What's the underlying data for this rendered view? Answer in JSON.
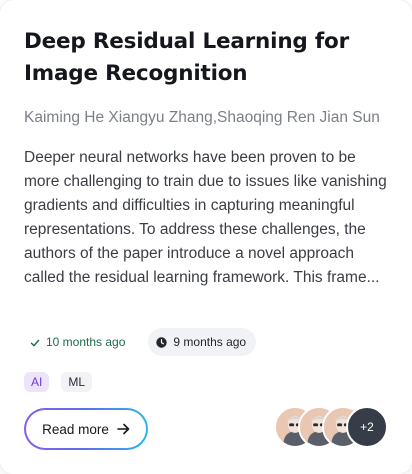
{
  "card": {
    "title": "Deep Residual Learning for Image Recognition",
    "authors": "Kaiming He Xiangyu Zhang,Shaoqing Ren Jian Sun",
    "abstract": "Deeper neural networks have been proven to be more challenging to train due to issues like vanishing gradients and difficulties in capturing meaningful representations. To address these challenges, the authors of the paper introduce a novel approach called the residual learning framework. This frame...",
    "updated": "10 months ago",
    "created": "9 months ago",
    "tags": [
      "AI",
      "ML"
    ],
    "read_more_label": "Read more",
    "more_contributors": "+2"
  },
  "icons": {
    "updated": "check-icon",
    "created": "clock-icon",
    "read_more": "arrow-right-icon"
  },
  "colors": {
    "tag_ai_bg": "#ede4fb",
    "tag_ai_fg": "#6e3ad0",
    "updated_fg": "#1e6b4a",
    "button_gradient": [
      "#8a5cf0",
      "#5a6ff0",
      "#2fb5e8"
    ],
    "avatar_more_bg": "#363d49"
  }
}
